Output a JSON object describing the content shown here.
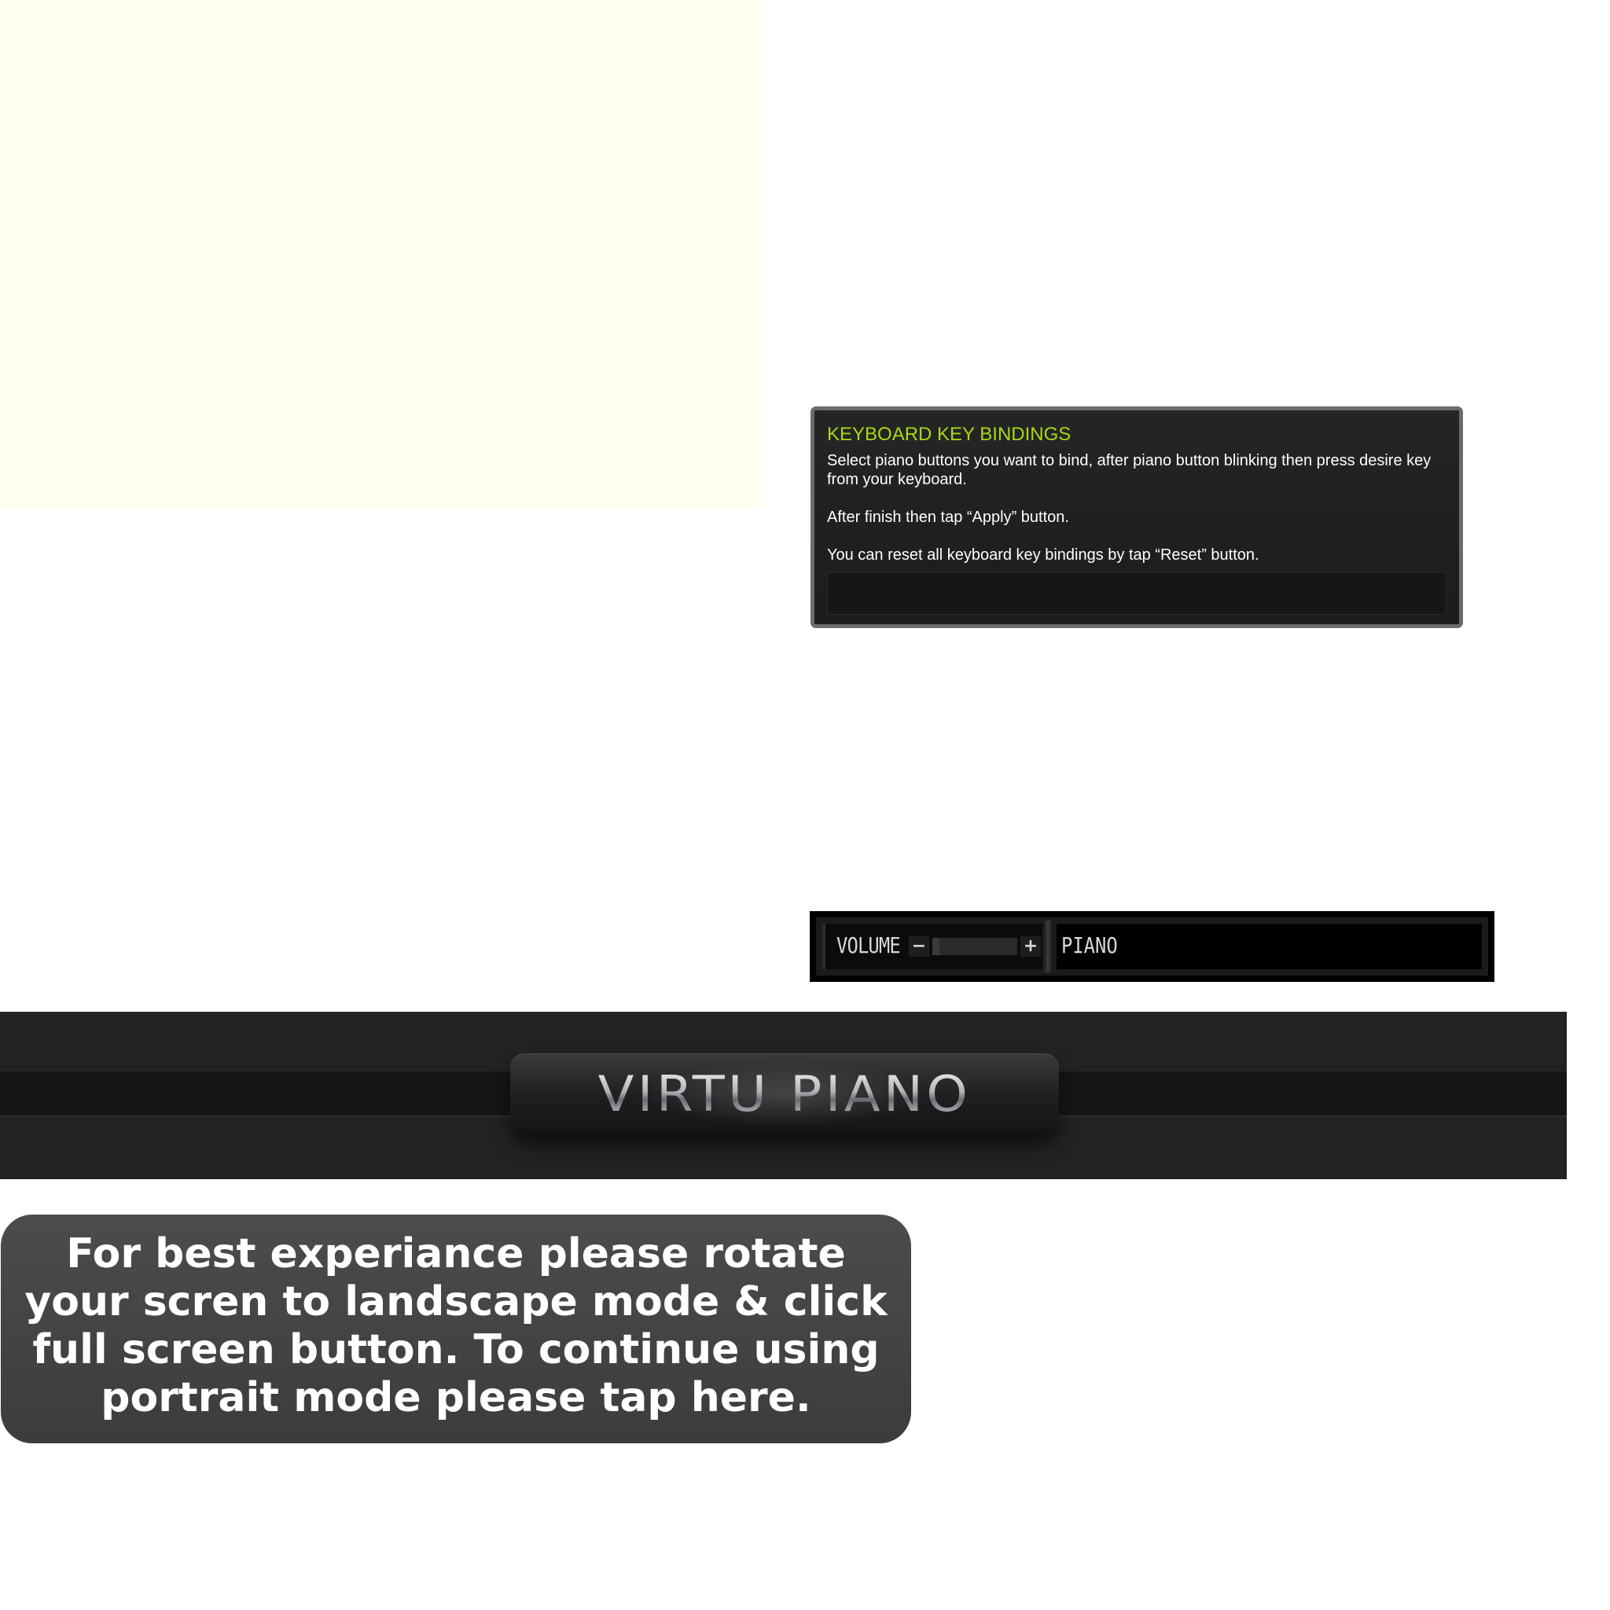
{
  "key_bindings": {
    "title": "KEYBOARD KEY BINDINGS",
    "instruction_1": "Select piano buttons you want to bind, after piano button blinking then press desire key from your keyboard.",
    "instruction_2": "After finish then tap “Apply” button.",
    "instruction_3": "You can reset all keyboard key bindings by tap “Reset” button."
  },
  "controls": {
    "volume_label": "VOLUME",
    "volume_minus": "−",
    "volume_plus": "+",
    "volume_level_percent": 8,
    "instrument_label": "PIANO"
  },
  "header": {
    "logo_text": "VIRTU PIANO"
  },
  "rotate_notice": {
    "text": "For best experiance please rotate your scren to landscape mode & click full screen button. To continue using portrait mode please tap here."
  },
  "colors": {
    "accent_title": "#a8d816",
    "notice_bg": "#414345",
    "panel_bg": "#ffffed"
  }
}
